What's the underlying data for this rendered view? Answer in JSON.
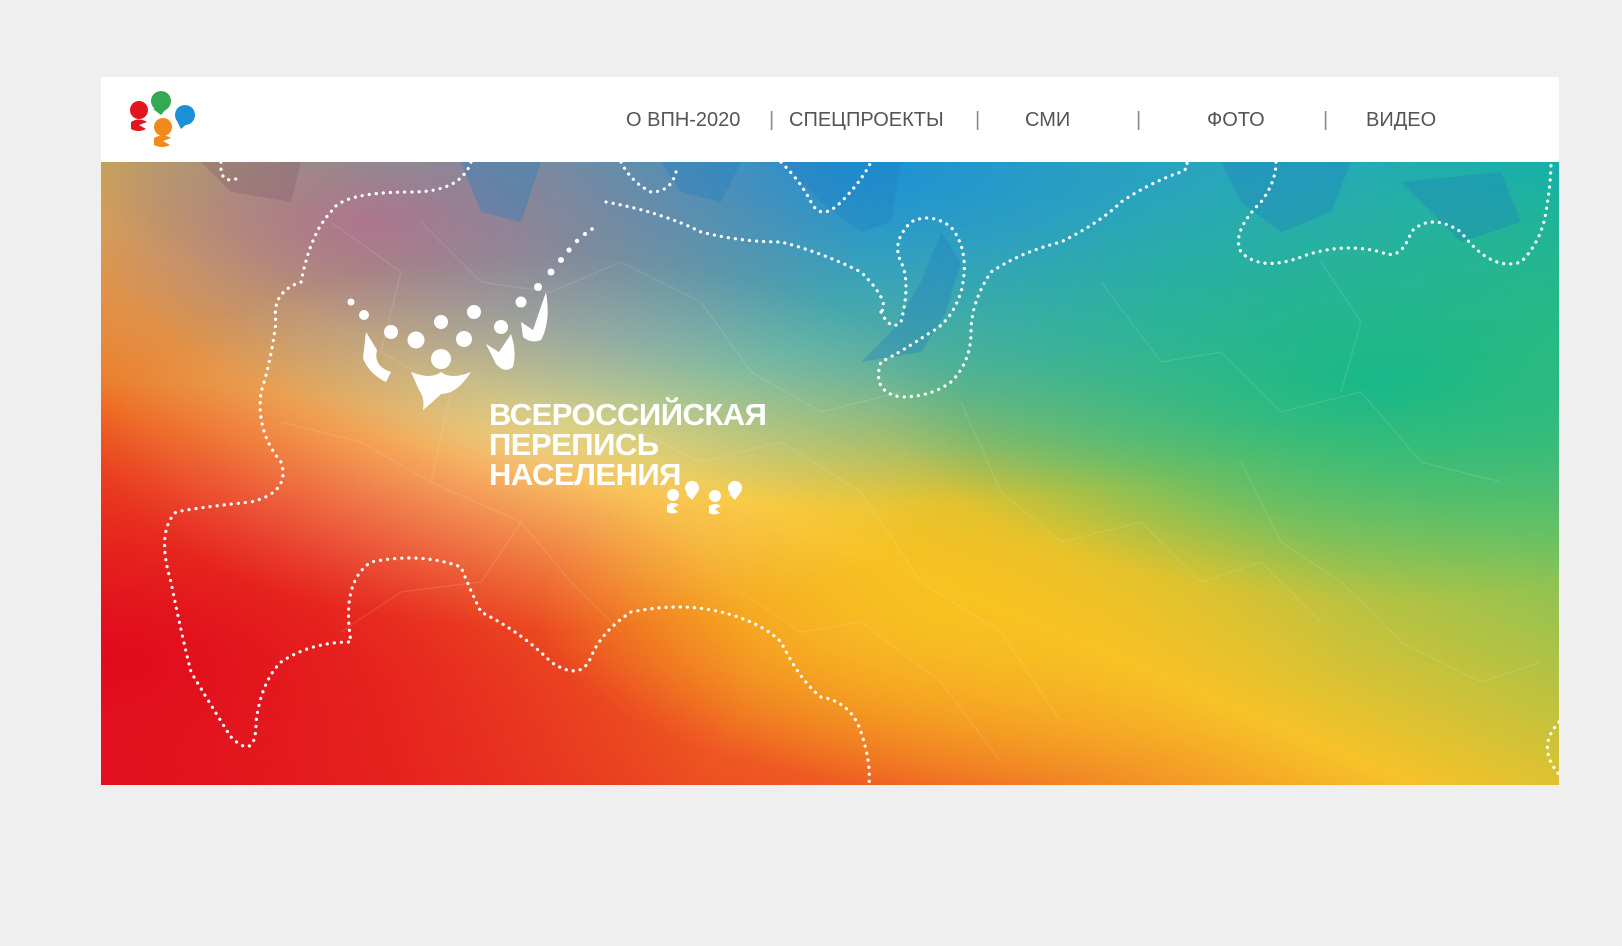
{
  "header": {
    "logo_icon": "census-people-logo-icon",
    "nav": [
      {
        "label": "О ВПН-2020"
      },
      {
        "label": "СПЕЦПРОЕКТЫ"
      },
      {
        "label": "СМИ"
      },
      {
        "label": "ФОТО"
      },
      {
        "label": "ВИДЕО"
      }
    ],
    "separator": "|"
  },
  "hero": {
    "title_line1": "ВСЕРОССИЙСКАЯ",
    "title_line2": "ПЕРЕПИСЬ",
    "title_line3": "НАСЕЛЕНИЯ",
    "emblem_icon": "firework-people-emblem-icon",
    "year_mark_icon": "2020-people-mark-icon",
    "background": "russia-map-rainbow-gradient"
  },
  "colors": {
    "red": "#e3141e",
    "orange": "#f08a1c",
    "yellow": "#f7c228",
    "green": "#18b86a",
    "teal": "#0fb3b5",
    "blue": "#1d8fd6",
    "nav_text": "#555555"
  }
}
